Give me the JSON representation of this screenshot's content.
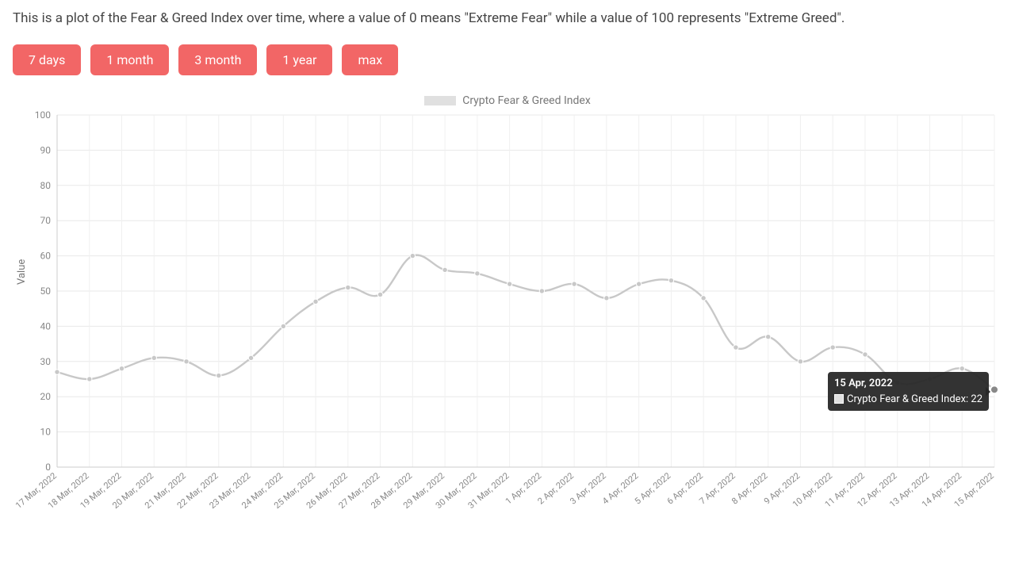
{
  "description": "This is a plot of the Fear & Greed Index over time, where a value of 0 means \"Extreme Fear\" while a value of 100 represents \"Extreme Greed\".",
  "range_buttons": [
    "7 days",
    "1 month",
    "3 month",
    "1 year",
    "max"
  ],
  "legend": {
    "label": "Crypto Fear & Greed Index"
  },
  "tooltip": {
    "title": "15 Apr, 2022",
    "series_label": "Crypto Fear & Greed Index",
    "value": 22
  },
  "axes": {
    "ylabel": "Value"
  },
  "chart_data": {
    "type": "line",
    "title": "",
    "xlabel": "",
    "ylabel": "Value",
    "ylim": [
      0,
      100
    ],
    "yticks": [
      0,
      10,
      20,
      30,
      40,
      50,
      60,
      70,
      80,
      90,
      100
    ],
    "legend": "Crypto Fear & Greed Index",
    "categories": [
      "17 Mar, 2022",
      "18 Mar, 2022",
      "19 Mar, 2022",
      "20 Mar, 2022",
      "21 Mar, 2022",
      "22 Mar, 2022",
      "23 Mar, 2022",
      "24 Mar, 2022",
      "25 Mar, 2022",
      "26 Mar, 2022",
      "27 Mar, 2022",
      "28 Mar, 2022",
      "29 Mar, 2022",
      "30 Mar, 2022",
      "31 Mar, 2022",
      "1 Apr, 2022",
      "2 Apr, 2022",
      "3 Apr, 2022",
      "4 Apr, 2022",
      "5 Apr, 2022",
      "6 Apr, 2022",
      "7 Apr, 2022",
      "8 Apr, 2022",
      "9 Apr, 2022",
      "10 Apr, 2022",
      "11 Apr, 2022",
      "12 Apr, 2022",
      "13 Apr, 2022",
      "14 Apr, 2022",
      "15 Apr, 2022"
    ],
    "series": [
      {
        "name": "Crypto Fear & Greed Index",
        "values": [
          27,
          25,
          28,
          31,
          30,
          26,
          31,
          40,
          47,
          51,
          49,
          60,
          56,
          55,
          52,
          50,
          52,
          48,
          52,
          53,
          48,
          34,
          37,
          30,
          34,
          32,
          24,
          25,
          28,
          22
        ]
      }
    ]
  }
}
